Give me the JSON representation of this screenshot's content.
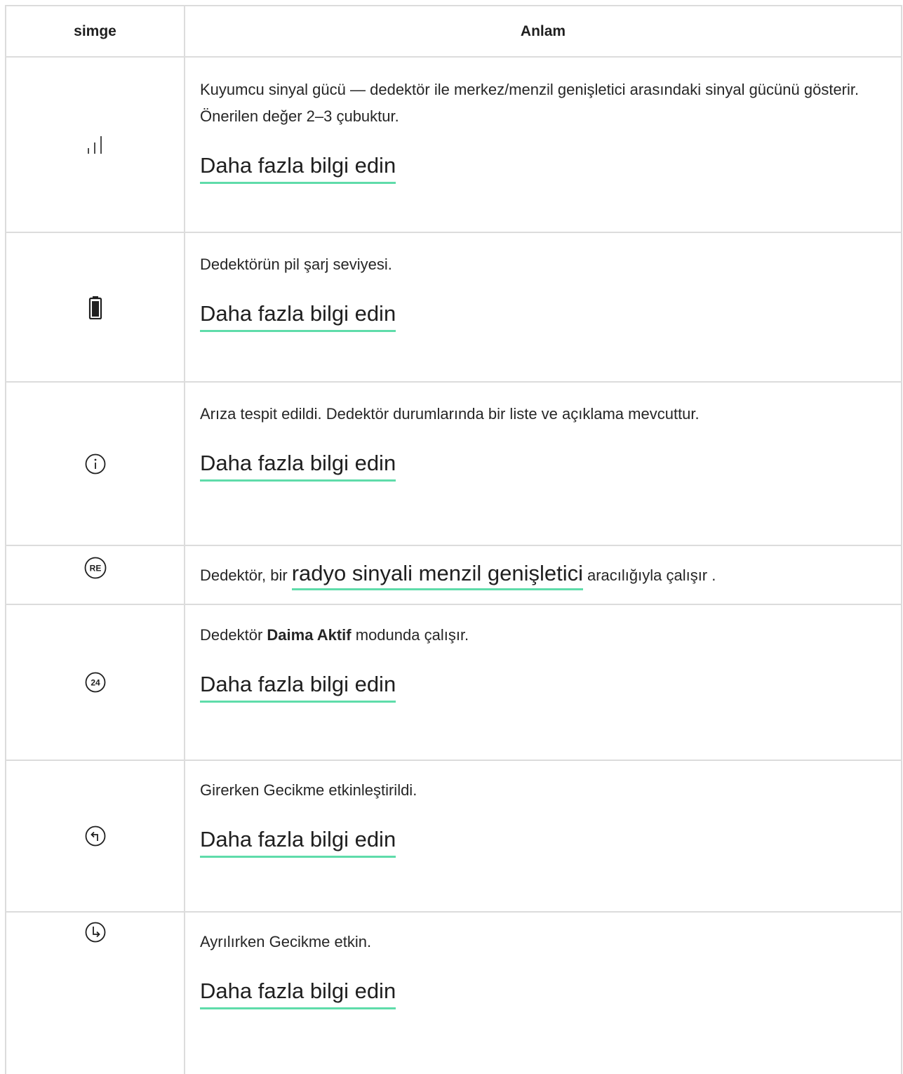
{
  "header": {
    "col1": "simge",
    "col2": "Anlam"
  },
  "link_label": "Daha fazla bilgi edin",
  "rows": [
    {
      "icon": "signal-strength-icon",
      "desc": "Kuyumcu sinyal gücü — dedektör ile merkez/menzil genişletici arasındaki sinyal gücünü gösterir. Önerilen değer 2–3 çubuktur."
    },
    {
      "icon": "battery-icon",
      "desc": "Dedektörün pil şarj seviyesi."
    },
    {
      "icon": "info-icon",
      "desc": "Arıza tespit edildi. Dedektör durumlarında bir liste ve açıklama mevcuttur."
    },
    {
      "icon": "re-icon",
      "icon_text": "RE",
      "desc_before": "Dedektör, bir",
      "link": "radyo sinyali menzil genişletici",
      "desc_after": "aracılığıyla çalışır ."
    },
    {
      "icon": "always-active-24-icon",
      "icon_text": "24",
      "desc_before": "Dedektör",
      "desc_bold": "Daima Aktif",
      "desc_after": "modunda çalışır."
    },
    {
      "icon": "entry-delay-icon",
      "desc": "Girerken Gecikme etkinleştirildi."
    },
    {
      "icon": "exit-delay-icon",
      "desc": "Ayrılırken Gecikme etkin."
    }
  ],
  "colors": {
    "border": "#dcdcdc",
    "link_underline": "#5fdcaa",
    "text": "#1f1f1f"
  }
}
